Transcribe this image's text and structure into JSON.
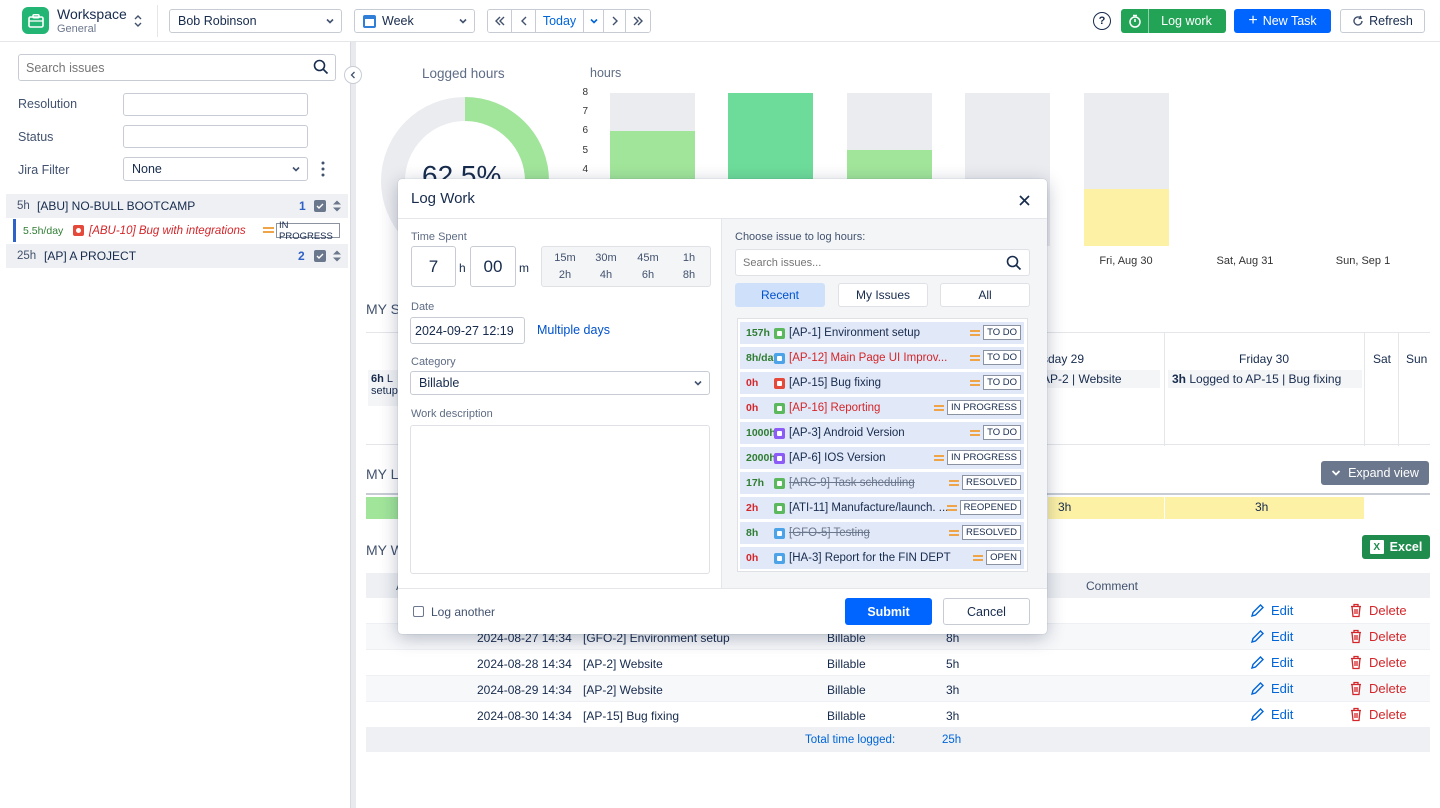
{
  "header": {
    "workspace_title": "Workspace",
    "workspace_subtitle": "General",
    "user_select": "Bob Robinson",
    "period_select": "Week",
    "today_label": "Today",
    "log_work_label": "Log work",
    "new_task_label": "New Task",
    "refresh_label": "Refresh"
  },
  "sidebar": {
    "search_placeholder": "Search issues",
    "resolution_label": "Resolution",
    "status_label": "Status",
    "jira_filter_label": "Jira Filter",
    "jira_filter_value": "None",
    "projects": [
      {
        "hours": "5h",
        "name": "[ABU] NO-BULL BOOTCAMP",
        "count": "1"
      },
      {
        "hours": "25h",
        "name": "[AP] A PROJECT",
        "count": "2"
      }
    ],
    "issue": {
      "rate": "5.5h/day",
      "title": "[ABU-10] Bug with integrations",
      "status": "IN PROGRESS"
    }
  },
  "main": {
    "logged_hours_title": "Logged hours",
    "donut_value": "62.5%",
    "donut_fraction": 0.625,
    "hours_axis_label": "hours",
    "y_ticks": [
      "8",
      "7",
      "6",
      "5",
      "4"
    ],
    "days": [
      "Fri, Aug 30",
      "Sat, Aug 31",
      "Sun, Sep 1"
    ],
    "section_schedule": "MY S",
    "section_log": "MY L",
    "section_worklog": "MY W",
    "calendar_cols": [
      "rsday 29",
      "Friday 30",
      "Sat",
      "Sun"
    ],
    "calendar_entries": [
      {
        "hours": "6h",
        "text": "L",
        "text2": "setup"
      },
      {
        "hours": "",
        "text": "AP-2 | Website"
      },
      {
        "hours": "3h",
        "text": "Logged to AP-15 | Bug fixing"
      }
    ],
    "expand_view_label": "Expand view",
    "bar_values": [
      "3h",
      "3h"
    ],
    "excel_label": "Excel",
    "worklog_comment_header": "Comment",
    "worklog_first_col": "A",
    "worklog_rows": [
      {
        "date": "",
        "issue": "",
        "category": "",
        "hours": "",
        "edit": "Edit",
        "delete": "Delete"
      },
      {
        "date": "2024-08-27 14:34",
        "issue": "[GFO-2] Environment setup",
        "category": "Billable",
        "hours": "8h",
        "edit": "Edit",
        "delete": "Delete"
      },
      {
        "date": "2024-08-28 14:34",
        "issue": "[AP-2] Website",
        "category": "Billable",
        "hours": "5h",
        "edit": "Edit",
        "delete": "Delete"
      },
      {
        "date": "2024-08-29 14:34",
        "issue": "[AP-2] Website",
        "category": "Billable",
        "hours": "3h",
        "edit": "Edit",
        "delete": "Delete"
      },
      {
        "date": "2024-08-30 14:34",
        "issue": "[AP-15] Bug fixing",
        "category": "Billable",
        "hours": "3h",
        "edit": "Edit",
        "delete": "Delete"
      }
    ],
    "total_label": "Total time logged:",
    "total_value": "25h"
  },
  "modal": {
    "title": "Log Work",
    "time_spent_label": "Time Spent",
    "hours_value": "7",
    "hours_unit": "h",
    "minutes_value": "00",
    "minutes_unit": "m",
    "quick_times": [
      "15m",
      "30m",
      "45m",
      "1h",
      "2h",
      "4h",
      "6h",
      "8h"
    ],
    "date_label": "Date",
    "date_value": "2024-09-27 12:19",
    "multiple_days_label": "Multiple days",
    "category_label": "Category",
    "category_value": "Billable",
    "work_description_label": "Work description",
    "log_another_label": "Log another",
    "submit_label": "Submit",
    "cancel_label": "Cancel",
    "choose_issue_label": "Choose issue to log hours:",
    "search_placeholder": "Search issues...",
    "tabs": [
      "Recent",
      "My Issues",
      "All"
    ],
    "issues": [
      {
        "hours": "157h",
        "key": "[AP-1] Environment setup",
        "status": "TO DO",
        "hcolor": "#2e7d32",
        "tcolor": "#172b4d",
        "type": "#5cb85c",
        "strike": false
      },
      {
        "hours": "8h/day",
        "key": "[AP-12] Main Page UI Improv...",
        "status": "TO DO",
        "hcolor": "#2e7d32",
        "tcolor": "#d4262a",
        "type": "#4da3e8",
        "strike": false
      },
      {
        "hours": "0h",
        "key": "[AP-15] Bug fixing",
        "status": "TO DO",
        "hcolor": "#d4262a",
        "tcolor": "#172b4d",
        "type": "#e5493a",
        "strike": false
      },
      {
        "hours": "0h",
        "key": "[AP-16] Reporting",
        "status": "IN PROGRESS",
        "hcolor": "#d4262a",
        "tcolor": "#d4262a",
        "type": "#5cb85c",
        "strike": false
      },
      {
        "hours": "1000h",
        "key": "[AP-3] Android Version",
        "status": "TO DO",
        "hcolor": "#2e7d32",
        "tcolor": "#172b4d",
        "type": "#8b5cf6",
        "strike": false
      },
      {
        "hours": "2000h",
        "key": "[AP-6] IOS Version",
        "status": "IN PROGRESS",
        "hcolor": "#2e7d32",
        "tcolor": "#172b4d",
        "type": "#8b5cf6",
        "strike": false
      },
      {
        "hours": "17h",
        "key": "[ARC-9] Task scheduling",
        "status": "RESOLVED",
        "hcolor": "#2e7d32",
        "tcolor": "#6b778c",
        "type": "#5cb85c",
        "strike": true
      },
      {
        "hours": "2h",
        "key": "[ATI-11] Manufacture/launch. ...",
        "status": "REOPENED",
        "hcolor": "#d4262a",
        "tcolor": "#172b4d",
        "type": "#5cb85c",
        "strike": false
      },
      {
        "hours": "8h",
        "key": "[GFO-5] Testing",
        "status": "RESOLVED",
        "hcolor": "#2e7d32",
        "tcolor": "#6b778c",
        "type": "#4da3e8",
        "strike": true
      },
      {
        "hours": "0h",
        "key": "[HA-3] Report for the FIN DEPT",
        "status": "OPEN",
        "hcolor": "#d4262a",
        "tcolor": "#172b4d",
        "type": "#4da3e8",
        "strike": false
      }
    ]
  },
  "chart_data": {
    "type": "bar",
    "ylabel": "hours",
    "ylim": [
      0,
      8
    ],
    "categories": [
      "",
      "",
      "",
      "Fri, Aug 30",
      "Sat, Aug 31",
      "Sun, Sep 1"
    ],
    "series": [
      {
        "values": [
          6,
          8,
          5,
          0,
          3,
          0
        ]
      }
    ]
  },
  "colors": {
    "accent": "#0065ff",
    "green": "#00a36c",
    "bar_green": "#a1e59a",
    "bar_green_full": "#6ddc9a",
    "bar_yellow": "#fdf1a6"
  }
}
